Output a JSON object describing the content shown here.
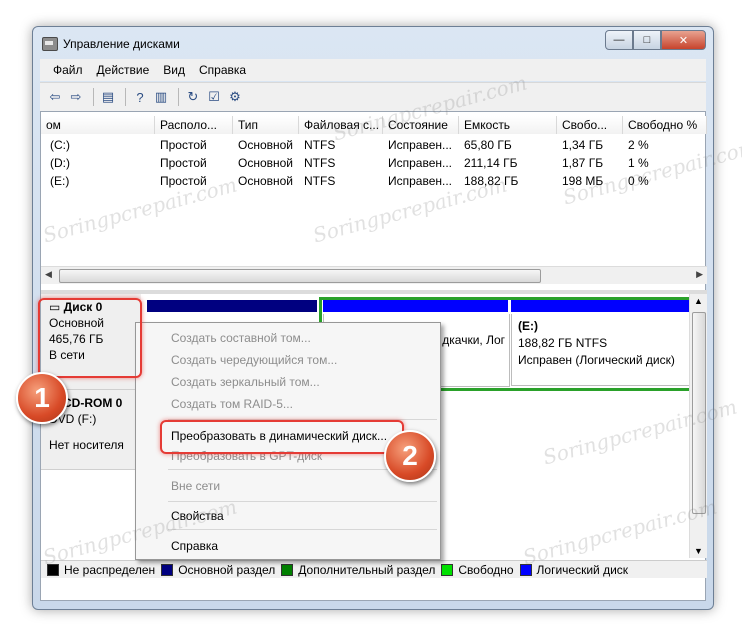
{
  "window": {
    "title": "Управление дисками",
    "min": "—",
    "max": "□",
    "close": "✕"
  },
  "menu": [
    "Файл",
    "Действие",
    "Вид",
    "Справка"
  ],
  "toolbar": [
    {
      "icon": "back-arrow-icon",
      "glyph": "⇦"
    },
    {
      "icon": "forward-arrow-icon",
      "glyph": "⇨"
    },
    {
      "icon": "console-tree-icon",
      "glyph": "▤"
    },
    {
      "icon": "help-icon",
      "glyph": "?"
    },
    {
      "icon": "details-icon",
      "glyph": "▥"
    },
    {
      "icon": "refresh-icon",
      "glyph": "↻"
    },
    {
      "icon": "properties-icon",
      "glyph": "☑"
    },
    {
      "icon": "settings-icon",
      "glyph": "⚙"
    }
  ],
  "columns": [
    "ом",
    "Располо...",
    "Тип",
    "Файловая с...",
    "Состояние",
    "Емкость",
    "Свобо...",
    "Свободно %"
  ],
  "volumes": [
    [
      "(C:)",
      "Простой",
      "Основной",
      "NTFS",
      "Исправен...",
      "65,80 ГБ",
      "1,34 ГБ",
      "2 %"
    ],
    [
      "(D:)",
      "Простой",
      "Основной",
      "NTFS",
      "Исправен...",
      "211,14 ГБ",
      "1,87 ГБ",
      "1 %"
    ],
    [
      "(E:)",
      "Простой",
      "Основной",
      "NTFS",
      "Исправен...",
      "188,82 ГБ",
      "198 МБ",
      "0 %"
    ]
  ],
  "disk0": {
    "name": "Диск 0",
    "type": "Основной",
    "size": "465,76 ГБ",
    "status": "В сети"
  },
  "cdrom": {
    "name": "CD-ROM 0",
    "type": "DVD (F:)",
    "status": "Нет носителя"
  },
  "partition_d_tail": "дкачки, Лог",
  "partition_e": {
    "name": "(E:)",
    "size": "188,82 ГБ NTFS",
    "status": "Исправен (Логический диск)"
  },
  "legend": [
    {
      "label": "Не распределен",
      "color": "#000000"
    },
    {
      "label": "Основной раздел",
      "color": "#000080"
    },
    {
      "label": "Дополнительный раздел",
      "color": "#008000"
    },
    {
      "label": "Свободно",
      "color": "#00e000"
    },
    {
      "label": "Логический диск",
      "color": "#0000ff"
    }
  ],
  "context_menu": [
    {
      "label": "Создать составной том...",
      "disabled": true
    },
    {
      "label": "Создать чередующийся том...",
      "disabled": true
    },
    {
      "label": "Создать зеркальный том...",
      "disabled": true
    },
    {
      "label": "Создать том RAID-5...",
      "disabled": true
    },
    {
      "label": "Преобразовать в динамический диск...",
      "disabled": false
    },
    {
      "label": "Преобразовать в GPT-диск",
      "disabled": true
    },
    {
      "label": "Вне сети",
      "disabled": true
    },
    {
      "label": "Свойства",
      "disabled": false
    },
    {
      "label": "Справка",
      "disabled": false
    }
  ],
  "badges": [
    "1",
    "2"
  ],
  "watermark": "Soringpcrepair.com"
}
